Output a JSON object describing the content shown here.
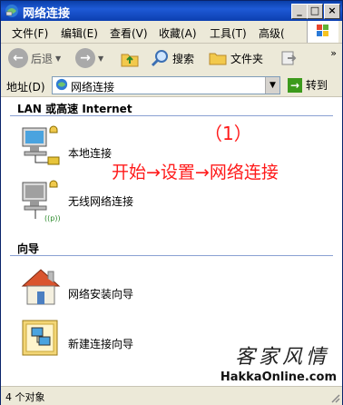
{
  "window": {
    "title": "网络连接"
  },
  "menu": [
    "文件(F)",
    "编辑(E)",
    "查看(V)",
    "收藏(A)",
    "工具(T)",
    "高级("
  ],
  "toolbar": {
    "back": "后退",
    "search": "搜索",
    "folders": "文件夹"
  },
  "address": {
    "label": "地址(D)",
    "value": "网络连接",
    "go": "转到"
  },
  "groups": {
    "lan": {
      "title": "LAN 或高速 Internet",
      "items": [
        "本地连接",
        "无线网络连接"
      ]
    },
    "wizard": {
      "title": "向导",
      "items": [
        "网络安装向导",
        "新建连接向导"
      ]
    }
  },
  "annotation": {
    "number": "（1）",
    "path": "开始→设置→网络连接"
  },
  "signature": "客家风情",
  "watermark": "HakkaOnline.com",
  "status": {
    "text": "4 个对象"
  },
  "colors": {
    "title_bar": "#0a3fa8",
    "annotation": "#ff1a1a",
    "group_line": "#8aa0d2"
  }
}
